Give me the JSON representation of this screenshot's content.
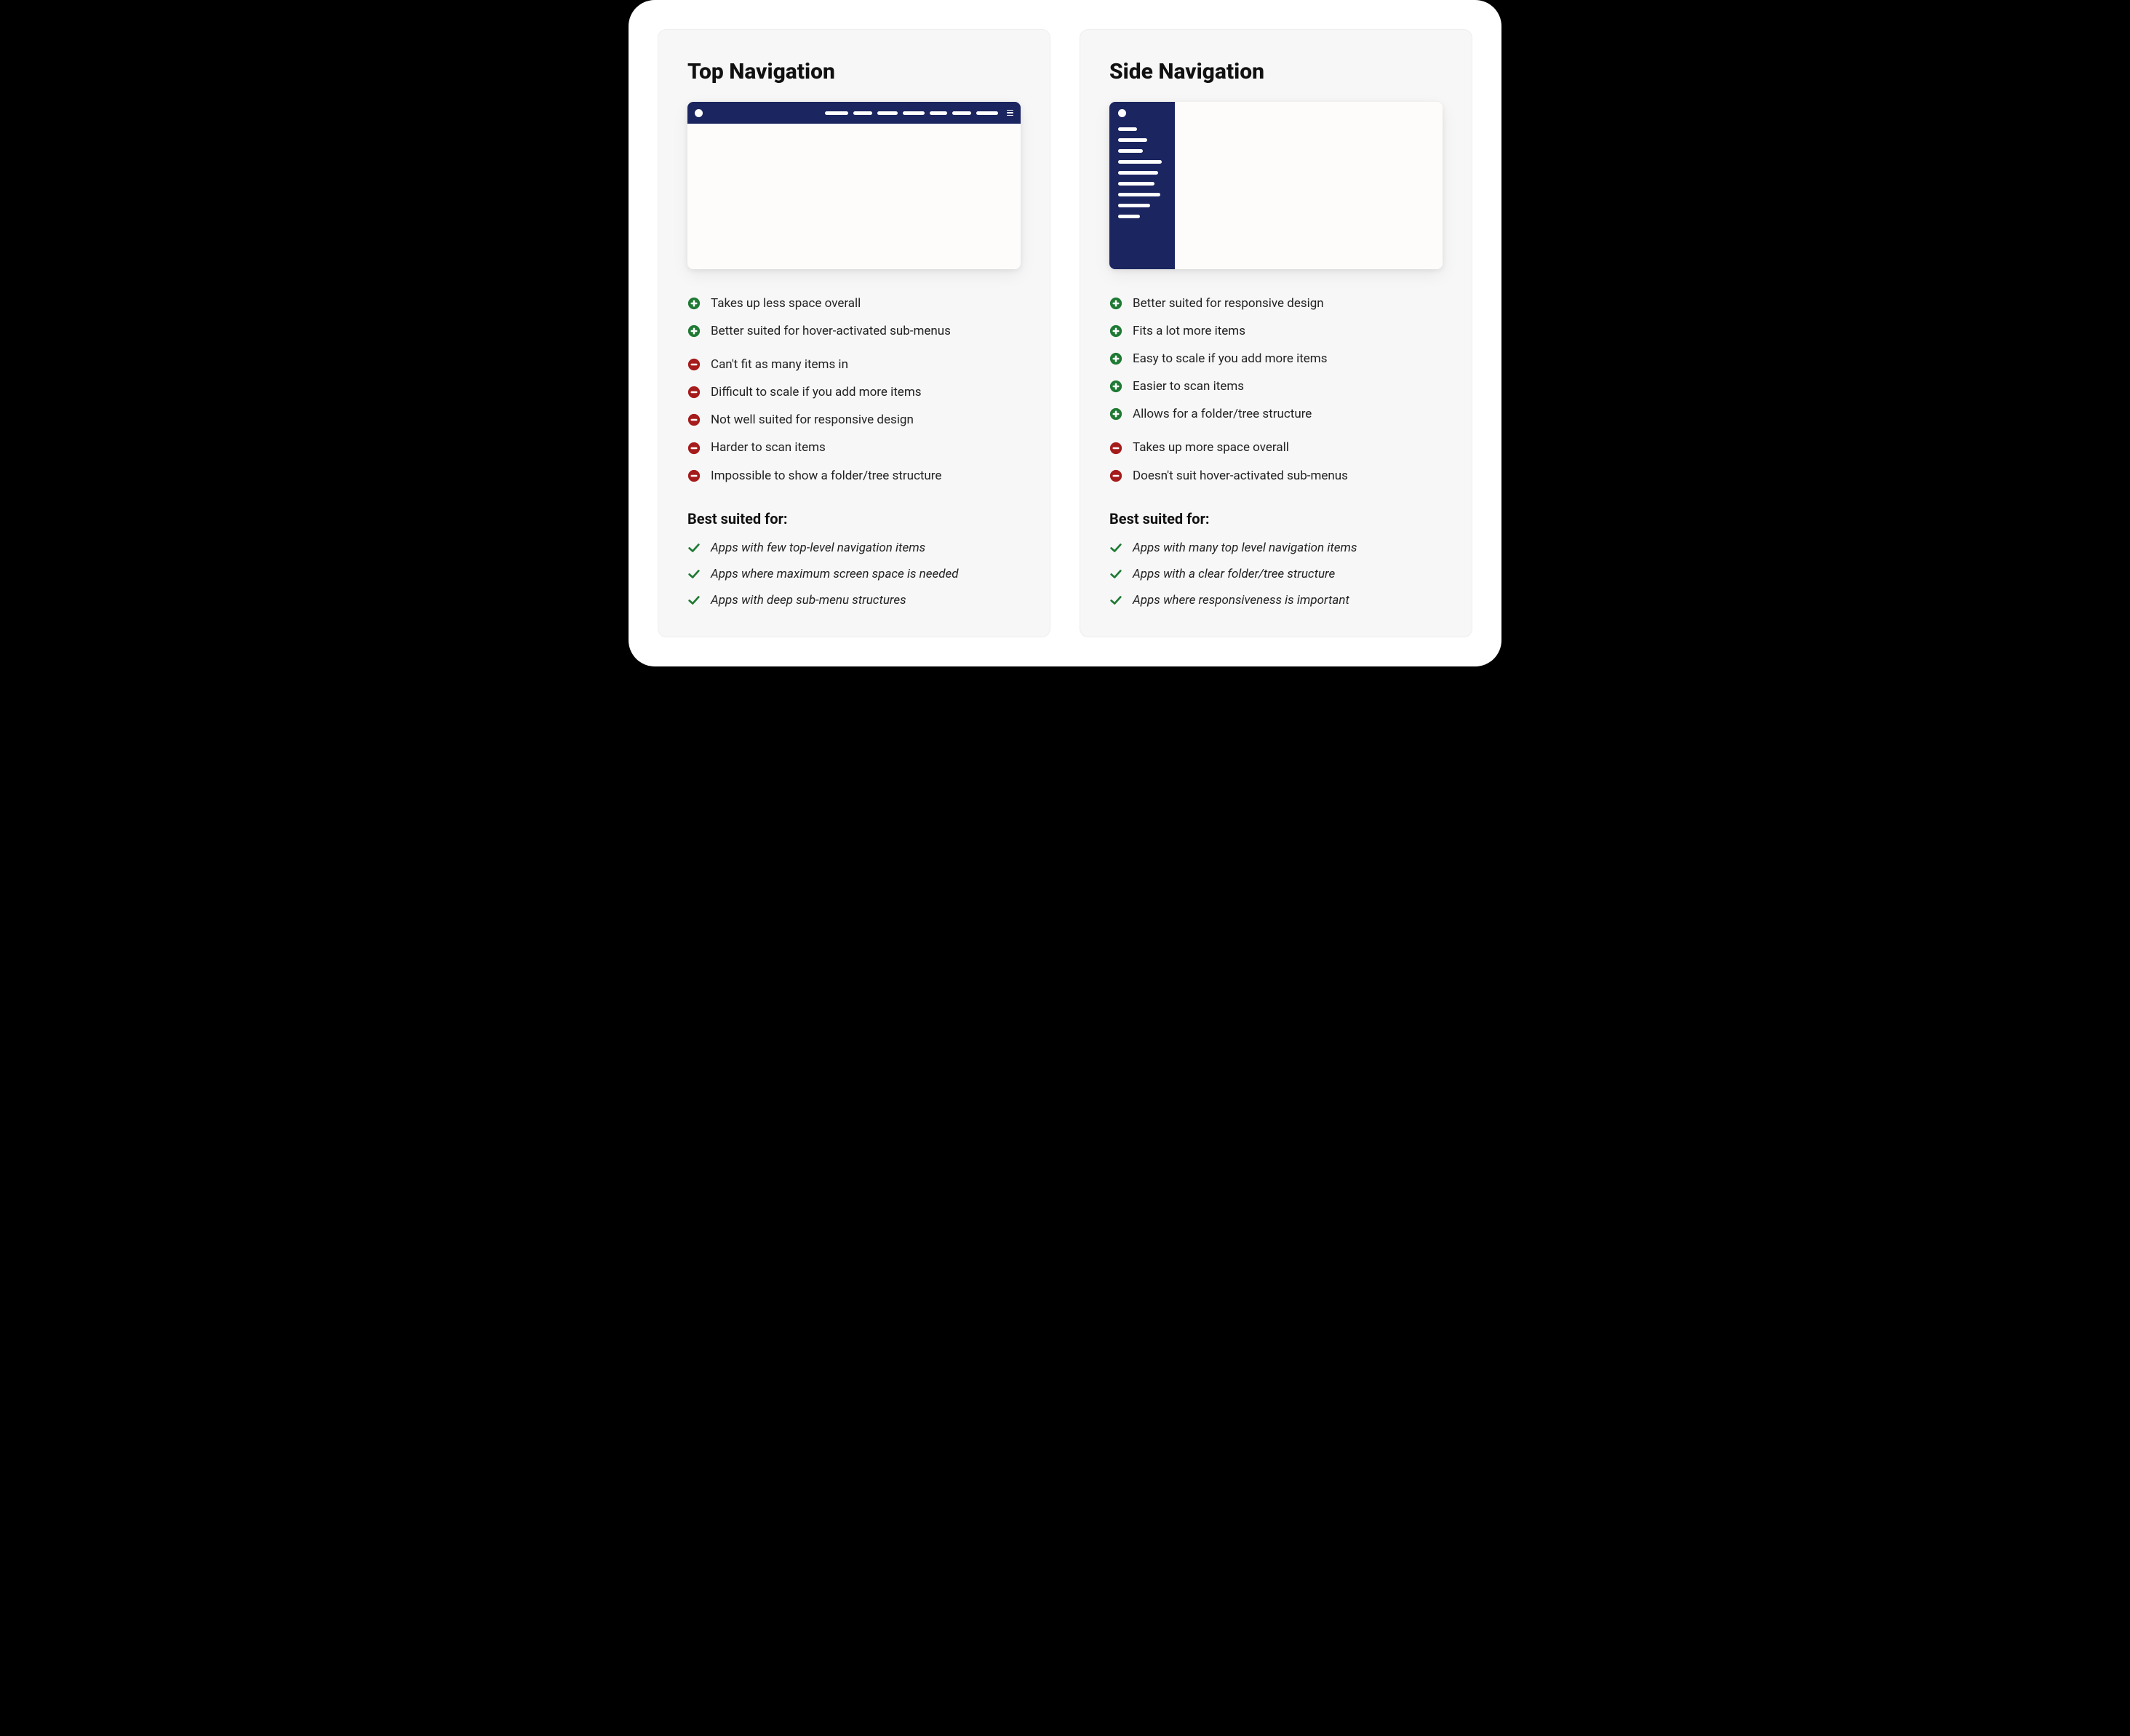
{
  "colors": {
    "navy": "#1b2560",
    "pro_green": "#1f7a34",
    "con_red": "#a61b1b",
    "check_green": "#1f7a34"
  },
  "cards": [
    {
      "title": "Top Navigation",
      "mockup": "top",
      "pros": [
        "Takes up less space overall",
        "Better suited for hover-activated sub-menus"
      ],
      "cons": [
        "Can't fit as many items in",
        "Difficult to scale if you add more items",
        "Not well suited for responsive design",
        "Harder to scan items",
        "Impossible to show a folder/tree structure"
      ],
      "best_heading": "Best suited for:",
      "best": [
        "Apps with few top-level navigation items",
        "Apps where maximum screen space is needed",
        "Apps with deep sub-menu structures"
      ]
    },
    {
      "title": "Side Navigation",
      "mockup": "side",
      "pros": [
        "Better suited for responsive design",
        "Fits a lot more items",
        "Easy to scale if you add more items",
        "Easier to scan items",
        "Allows for a folder/tree structure"
      ],
      "cons": [
        "Takes up more space overall",
        "Doesn't suit hover-activated sub-menus"
      ],
      "best_heading": "Best suited for:",
      "best": [
        "Apps with many top level navigation items",
        "Apps with a clear folder/tree structure",
        "Apps where responsiveness is important"
      ]
    }
  ]
}
